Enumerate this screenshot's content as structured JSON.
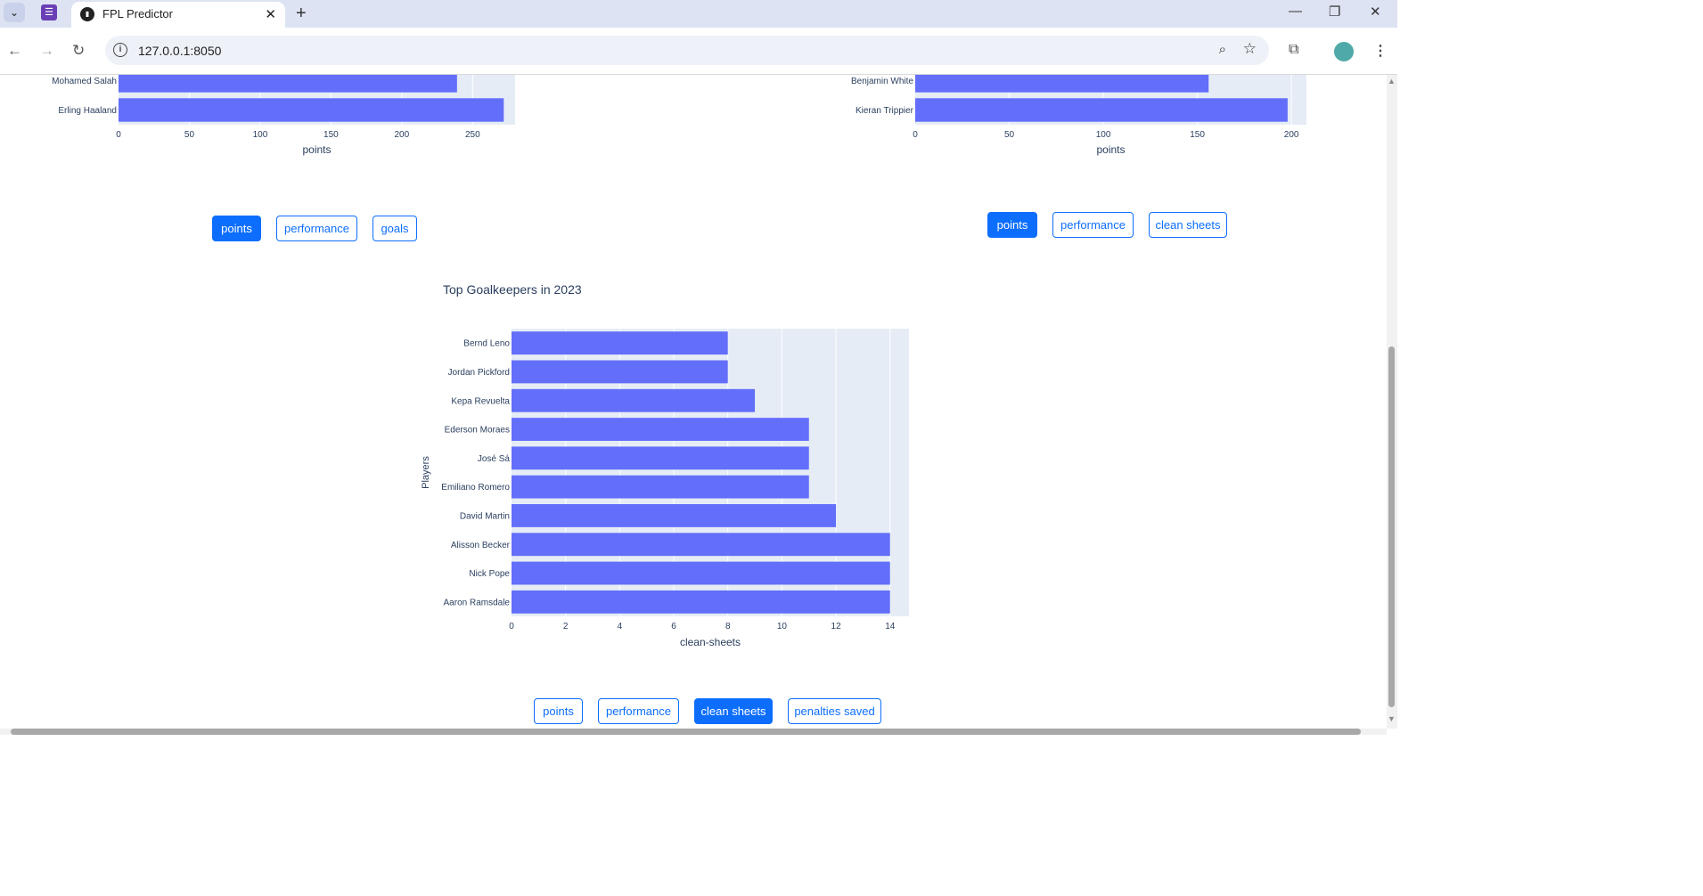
{
  "browser": {
    "tab_title": "FPL Predictor",
    "url": "127.0.0.1:8050"
  },
  "icons": [
    "chevron-down-icon",
    "extension-tab-icon",
    "site-favicon",
    "close-icon",
    "new-tab-icon",
    "minimize-icon",
    "restore-icon",
    "window-close-icon",
    "back-icon",
    "forward-icon",
    "reload-icon",
    "info-icon",
    "zoom-icon",
    "star-icon",
    "extensions-icon",
    "avatar-icon",
    "menu-icon"
  ],
  "forwards_chart": {
    "controls": {
      "points": "points",
      "performance": "performance",
      "goals": "goals"
    },
    "chart_data": {
      "type": "bar",
      "orientation": "horizontal",
      "categories": [
        "Mohamed Salah",
        "Erling Haaland"
      ],
      "values": [
        239,
        272
      ],
      "xlabel": "points",
      "ticks": [
        0,
        50,
        100,
        150,
        200,
        250
      ],
      "xlim": [
        0,
        280
      ],
      "color": "#636efa"
    }
  },
  "defenders_chart": {
    "controls": {
      "points": "points",
      "performance": "performance",
      "clean_sheets": "clean sheets"
    },
    "chart_data": {
      "type": "bar",
      "orientation": "horizontal",
      "categories": [
        "Benjamin White",
        "Kieran Trippier"
      ],
      "values": [
        156,
        198
      ],
      "xlabel": "points",
      "ticks": [
        0,
        50,
        100,
        150,
        200
      ],
      "xlim": [
        0,
        208
      ],
      "color": "#636efa"
    }
  },
  "goalkeepers_chart": {
    "controls": {
      "points": "points",
      "performance": "performance",
      "clean_sheets": "clean sheets",
      "penalties_saved": "penalties saved"
    },
    "chart_data": {
      "type": "bar",
      "orientation": "horizontal",
      "title": "Top Goalkeepers in 2023",
      "categories": [
        "Bernd Leno",
        "Jordan Pickford",
        "Kepa Revuelta",
        "Ederson Moraes",
        "José Sá",
        "Emiliano Romero",
        "David Martin",
        "Alisson Becker",
        "Nick Pope",
        "Aaron Ramsdale"
      ],
      "values": [
        8,
        8,
        9,
        11,
        11,
        11,
        12,
        14,
        14,
        14
      ],
      "xlabel": "clean-sheets",
      "ylabel": "Players",
      "ticks": [
        0,
        2,
        4,
        6,
        8,
        10,
        12,
        14
      ],
      "xlim": [
        0,
        14.7
      ],
      "color": "#636efa"
    }
  }
}
